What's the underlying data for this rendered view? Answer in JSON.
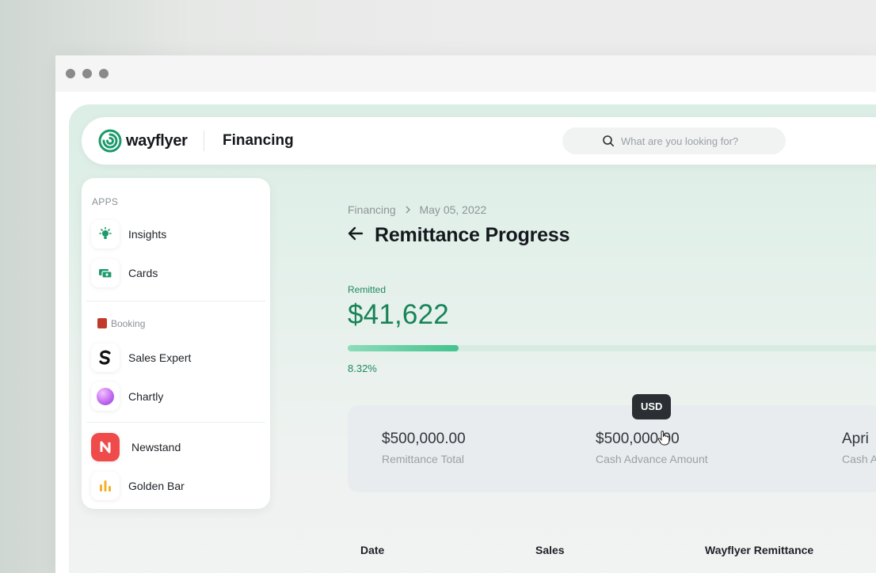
{
  "window": {
    "controls": [
      "close",
      "minimize",
      "maximize"
    ]
  },
  "topbar": {
    "brand": "wayflyer",
    "section_title": "Financing",
    "search_placeholder": "What are you looking for?"
  },
  "sidebar": {
    "section_apps": "APPS",
    "section_booking": "Booking",
    "items": [
      {
        "label": "Insights",
        "icon": "lightbulb-icon"
      },
      {
        "label": "Cards",
        "icon": "cards-icon"
      },
      {
        "label": "Sales Expert",
        "icon": "sales-expert-icon"
      },
      {
        "label": "Chartly",
        "icon": "chartly-orb-icon"
      },
      {
        "label": "Newstand",
        "icon": "newstand-n-icon"
      },
      {
        "label": "Golden Bar",
        "icon": "golden-bar-icon"
      }
    ]
  },
  "breadcrumb": {
    "parent": "Financing",
    "current": "May 05, 2022"
  },
  "page": {
    "title": "Remittance Progress"
  },
  "remitted": {
    "label": "Remitted",
    "amount": "$41,622",
    "percent_text": "8.32%",
    "percent_value": 8.32
  },
  "stats": [
    {
      "value": "$500,000.00",
      "label": "Remittance Total"
    },
    {
      "value": "$500,000.00",
      "label": "Cash Advance Amount"
    },
    {
      "value": "Apri",
      "label": "Cash A"
    }
  ],
  "tooltip": "USD",
  "table": {
    "headers": [
      "Date",
      "Sales",
      "Wayflyer Remittance"
    ]
  },
  "colors": {
    "accent": "#178357",
    "progress": "#43c38d",
    "background": "#e3f0ea"
  }
}
